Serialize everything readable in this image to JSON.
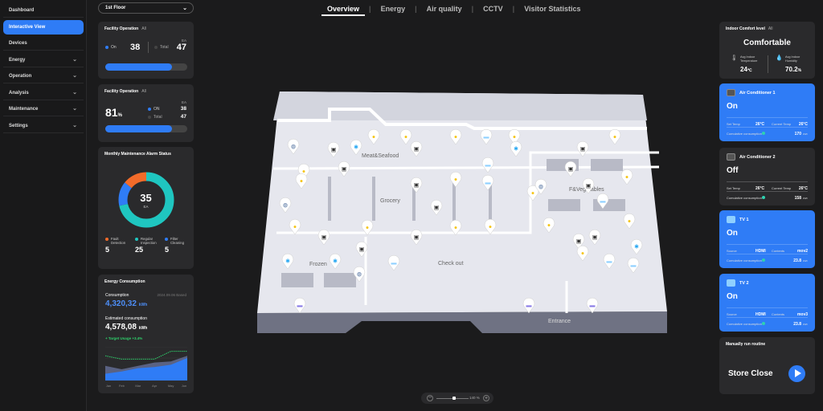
{
  "sidebar": {
    "items": [
      {
        "label": "Dashboard"
      },
      {
        "label": "Interactive View",
        "active": true
      },
      {
        "label": "Devices"
      },
      {
        "label": "Energy",
        "expandable": true
      },
      {
        "label": "Operation",
        "expandable": true
      },
      {
        "label": "Analysis",
        "expandable": true
      },
      {
        "label": "Maintenance",
        "expandable": true
      },
      {
        "label": "Settings",
        "expandable": true
      }
    ]
  },
  "floor_select": {
    "value": "1st Floor"
  },
  "tabs": [
    {
      "label": "Overview",
      "active": true
    },
    {
      "label": "Energy"
    },
    {
      "label": "Air quality"
    },
    {
      "label": "CCTV"
    },
    {
      "label": "Visitor Statistics"
    }
  ],
  "facility1": {
    "title": "Facility Operation",
    "filter": "All",
    "unit": "EA",
    "on_label": "On",
    "on": "38",
    "total_label": "Total",
    "total": "47",
    "progress": 0.81
  },
  "facility2": {
    "title": "Facility Operation",
    "filter": "All",
    "unit": "EA",
    "percent": "81",
    "percent_unit": "%",
    "on_label": "ON",
    "on": "38",
    "total_label": "Total",
    "total": "47",
    "progress": 0.81
  },
  "alarm": {
    "title": "Monthly Maintenance Alarm Status",
    "total": "35",
    "unit": "EA",
    "items": [
      {
        "label1": "Fault",
        "label2": "Detection",
        "value": "5",
        "color": "#f26b2a"
      },
      {
        "label1": "Regular",
        "label2": "Inspection",
        "value": "25",
        "color": "#1fc6c0"
      },
      {
        "label1": "Filter",
        "label2": "Cleaning",
        "value": "5",
        "color": "#2f7cf6"
      }
    ]
  },
  "energy": {
    "title": "Energy Consumption",
    "consumption_label": "Consumption",
    "date": "2024.09.06 Based",
    "consumption": "4,320,32",
    "unit": "kWh",
    "estimated_label": "Estimated consumption",
    "estimated": "4,578,08",
    "target": "Target Usage +3.4%",
    "chart": {
      "months": [
        "Jan",
        "Feb",
        "Mar",
        "Apr",
        "May",
        "Jun"
      ],
      "actual": [
        12,
        16,
        22,
        24,
        28,
        40
      ],
      "estimated": [
        26,
        20,
        26,
        32,
        34,
        44
      ],
      "target": [
        44,
        38,
        38,
        38,
        52,
        52
      ]
    }
  },
  "comfort": {
    "title": "Indoor Comfort level",
    "filter": "All",
    "status": "Comfortable",
    "temp_label1": "Avg Indoor",
    "temp_label2": "Temperature",
    "temp": "24",
    "temp_unit": "℃",
    "hum_label1": "Avg Indoor",
    "hum_label2": "Humidity",
    "hum": "70.2",
    "hum_unit": "%"
  },
  "devices": [
    {
      "name": "Air Conditioner 1",
      "state": "On",
      "active": true,
      "type": "ac",
      "r1a": "Set Temp",
      "r1av": "26°C",
      "r1b": "Current Temp",
      "r1bv": "26°C",
      "r2": "Cumulative consumption",
      "r2v": "170",
      "unit": "kWh"
    },
    {
      "name": "Air Conditioner 2",
      "state": "Off",
      "active": false,
      "type": "ac",
      "r1a": "Set Temp",
      "r1av": "26°C",
      "r1b": "Current Temp",
      "r1bv": "26°C",
      "r2": "Cumulative consumption",
      "r2v": "158",
      "unit": "kWh"
    },
    {
      "name": "TV 1",
      "state": "On",
      "active": true,
      "type": "tv",
      "r1a": "Source",
      "r1av": "HDMI",
      "r1b": "Contents",
      "r1bv": "mov2",
      "r2": "Cumulative consumption",
      "r2v": "23.8",
      "unit": "kWh"
    },
    {
      "name": "TV 2",
      "state": "On",
      "active": true,
      "type": "tv",
      "r1a": "Source",
      "r1av": "HDMI",
      "r1b": "Contents",
      "r1bv": "mov3",
      "r2": "Cumulative consumption",
      "r2v": "23.8",
      "unit": "kWh"
    }
  ],
  "routine": {
    "title": "Manually run routine",
    "name": "Store Close"
  },
  "map": {
    "zones": [
      "Meat&Seafood",
      "Grocery",
      "Frozen",
      "Check out",
      "F&Vegetables",
      "Entrance"
    ]
  },
  "zoom": {
    "value": "140 %",
    "level": 0.55
  }
}
